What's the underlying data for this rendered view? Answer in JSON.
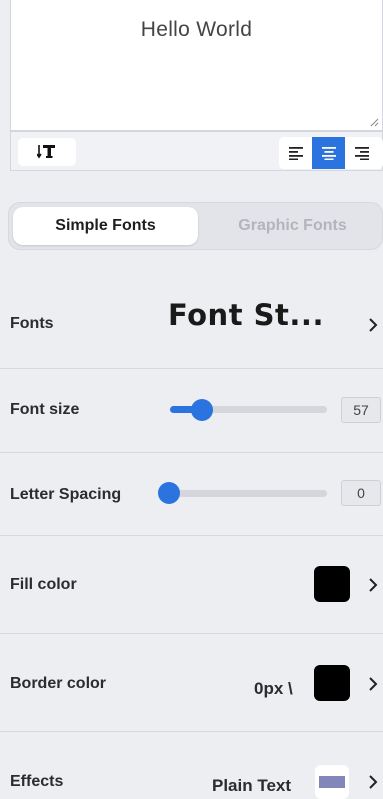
{
  "text_box": {
    "content": "Hello World"
  },
  "toolbar": {
    "text_transform_icon": "text-transform-icon",
    "align_options": [
      {
        "name": "align-left-icon",
        "active": false
      },
      {
        "name": "align-center-icon",
        "active": true
      },
      {
        "name": "align-right-icon",
        "active": false
      }
    ]
  },
  "tabs": {
    "simple": "Simple Fonts",
    "graphic": "Graphic Fonts"
  },
  "fonts": {
    "label": "Fonts",
    "preview": "Font St..."
  },
  "font_size": {
    "label": "Font size",
    "value": "57",
    "slider_fraction": 0.21
  },
  "letter_spacing": {
    "label": "Letter Spacing",
    "value": "0",
    "slider_fraction": 0.0
  },
  "fill_color": {
    "label": "Fill color",
    "color": "#000000"
  },
  "border_color": {
    "label": "Border color",
    "value": "0px \\",
    "color": "#000000"
  },
  "effects": {
    "label": "Effects",
    "value": "Plain Text",
    "swatch_color": "#8386b8"
  },
  "colors": {
    "accent": "#2b74e0",
    "background": "#eceef2"
  }
}
